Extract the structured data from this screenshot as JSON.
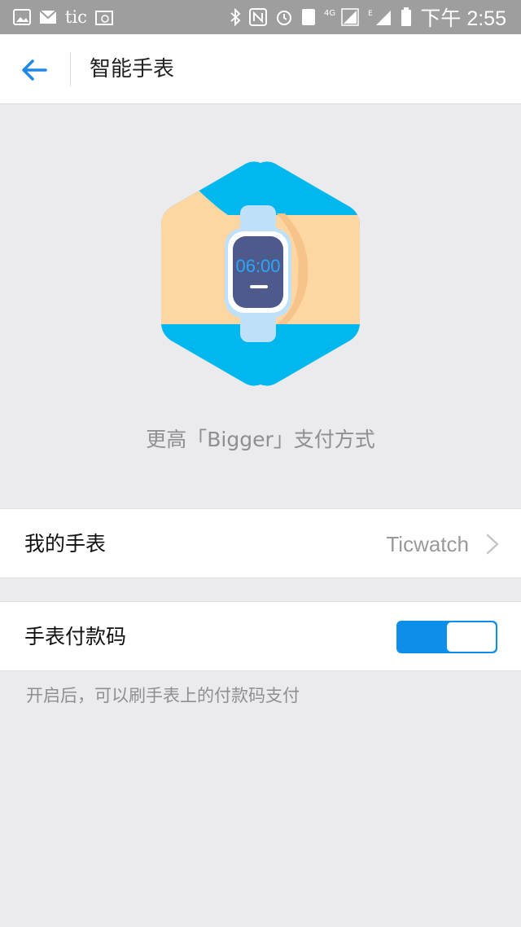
{
  "status_bar": {
    "carrier_text": "tic",
    "time": "下午 2:55",
    "network": "4G",
    "sim_badge": "1",
    "sim_e": "E"
  },
  "header": {
    "title": "智能手表"
  },
  "hero": {
    "watch_time": "06:00",
    "caption": "更高「Bigger」支付方式"
  },
  "my_watch": {
    "label": "我的手表",
    "value": "Ticwatch"
  },
  "pay_code": {
    "label": "手表付款码",
    "enabled": true,
    "hint": "开启后，可以刷手表上的付款码支付"
  },
  "colors": {
    "accent": "#0f8ee9",
    "hex_blue": "#00b7ee",
    "skin": "#fdd6a2",
    "watch_band": "#bfe0f9",
    "watch_face": "#4e5a8c"
  }
}
